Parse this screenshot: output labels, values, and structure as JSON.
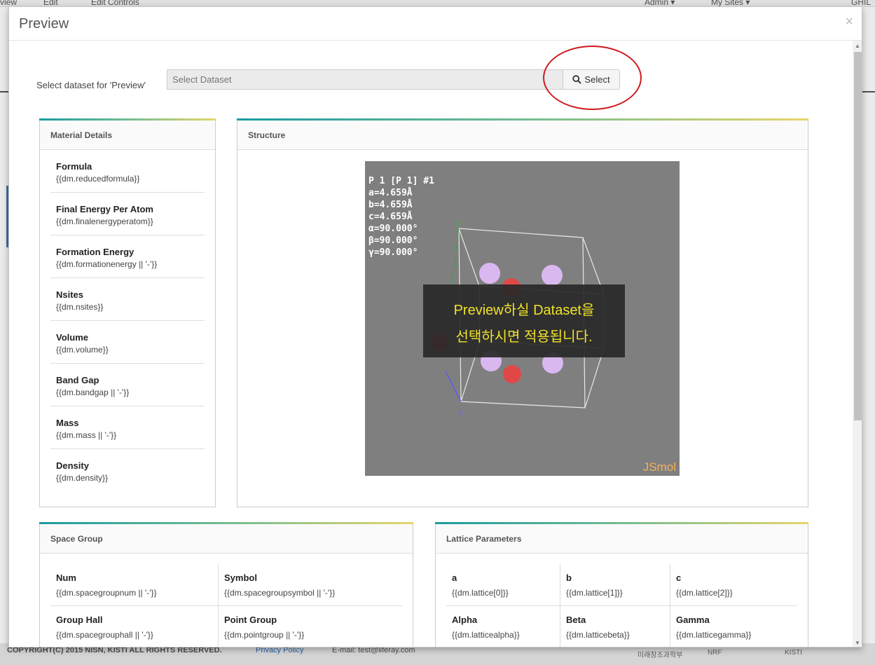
{
  "background": {
    "topbar": [
      "view",
      "Edit",
      "Edit Controls",
      "Admin ▾",
      "My Sites ▾",
      "GHIL"
    ],
    "footer": {
      "copyright": "COPYRIGHT(C) 2015 NISN, KISTI ALL RIGHTS RESERVED.",
      "privacy": "Privacy Policy",
      "email": "E-mail: test@liferay.com",
      "logos": [
        "미래창조과학부",
        "NRF",
        "KISTI"
      ]
    }
  },
  "modal": {
    "title": "Preview",
    "close": "×"
  },
  "dataset": {
    "label": "Select dataset for 'Preview'",
    "placeholder": "Select Dataset",
    "button": "Select"
  },
  "material_details": {
    "title": "Material Details",
    "items": [
      {
        "label": "Formula",
        "value": "{{dm.reducedformula}}"
      },
      {
        "label": "Final Energy Per Atom",
        "value": "{{dm.finalenergyperatom}}"
      },
      {
        "label": "Formation Energy",
        "value": "{{dm.formationenergy || '-'}}"
      },
      {
        "label": "Nsites",
        "value": "{{dm.nsites}}"
      },
      {
        "label": "Volume",
        "value": "{{dm.volume}}"
      },
      {
        "label": "Band Gap",
        "value": "{{dm.bandgap || '-'}}"
      },
      {
        "label": "Mass",
        "value": "{{dm.mass || '-'}}"
      },
      {
        "label": "Density",
        "value": "{{dm.density}}"
      }
    ]
  },
  "structure": {
    "title": "Structure",
    "info": [
      "P 1 [P 1] #1",
      "a=4.659Å",
      "b=4.659Å",
      "c=4.659Å",
      "α=90.000°",
      "β=90.000°",
      "γ=90.000°"
    ],
    "axes": [
      "b",
      "c"
    ],
    "banner_line1": "Preview하실 Dataset을",
    "banner_line2": "선택하시면 적용됩니다.",
    "brand": "JSmol"
  },
  "space_group": {
    "title": "Space Group",
    "rows": [
      [
        {
          "label": "Num",
          "value": "{{dm.spacegroupnum || '-'}}"
        },
        {
          "label": "Symbol",
          "value": "{{dm.spacegroupsymbol || '-'}}"
        }
      ],
      [
        {
          "label": "Group Hall",
          "value": "{{dm.spacegrouphall || '-'}}"
        },
        {
          "label": "Point Group",
          "value": "{{dm.pointgroup || '-'}}"
        }
      ]
    ]
  },
  "lattice": {
    "title": "Lattice Parameters",
    "rows": [
      [
        {
          "label": "a",
          "value": "{{dm.lattice[0]}}"
        },
        {
          "label": "b",
          "value": "{{dm.lattice[1]}}"
        },
        {
          "label": "c",
          "value": "{{dm.lattice[2]}}"
        }
      ],
      [
        {
          "label": "Alpha",
          "value": "{{dm.latticealpha}}"
        },
        {
          "label": "Beta",
          "value": "{{dm.latticebeta}}"
        },
        {
          "label": "Gamma",
          "value": "{{dm.latticegamma}}"
        }
      ]
    ]
  },
  "colors": {
    "accent_gradient": [
      "#199ba1",
      "#7cbf8e",
      "#e6d56a"
    ],
    "annotation": "#d0191e",
    "banner_text": "#f0e22a"
  }
}
